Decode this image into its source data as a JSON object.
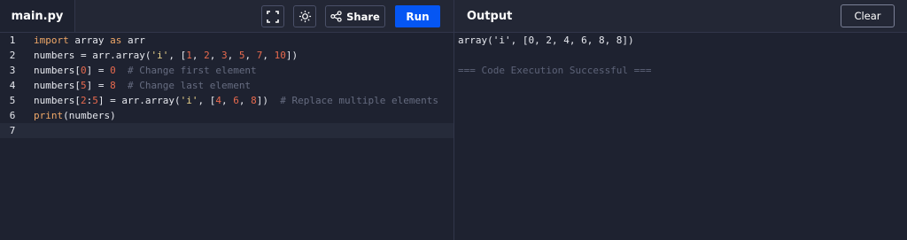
{
  "editor": {
    "filename": "main.py",
    "share_label": "Share",
    "run_label": "Run",
    "lines": [
      {
        "no": "1",
        "tokens": [
          [
            "kw",
            "import"
          ],
          [
            "txt",
            " array "
          ],
          [
            "kw",
            "as"
          ],
          [
            "txt",
            " arr"
          ]
        ]
      },
      {
        "no": "2",
        "tokens": [
          [
            "txt",
            "numbers = arr.array("
          ],
          [
            "str",
            "'i'"
          ],
          [
            "txt",
            ", ["
          ],
          [
            "num",
            "1"
          ],
          [
            "txt",
            ", "
          ],
          [
            "num",
            "2"
          ],
          [
            "txt",
            ", "
          ],
          [
            "num",
            "3"
          ],
          [
            "txt",
            ", "
          ],
          [
            "num",
            "5"
          ],
          [
            "txt",
            ", "
          ],
          [
            "num",
            "7"
          ],
          [
            "txt",
            ", "
          ],
          [
            "num",
            "10"
          ],
          [
            "txt",
            "])"
          ]
        ]
      },
      {
        "no": "3",
        "tokens": [
          [
            "txt",
            "numbers["
          ],
          [
            "num",
            "0"
          ],
          [
            "txt",
            "] = "
          ],
          [
            "num",
            "0"
          ],
          [
            "txt",
            "  "
          ],
          [
            "cmt",
            "# Change first element"
          ]
        ]
      },
      {
        "no": "4",
        "tokens": [
          [
            "txt",
            "numbers["
          ],
          [
            "num",
            "5"
          ],
          [
            "txt",
            "] = "
          ],
          [
            "num",
            "8"
          ],
          [
            "txt",
            "  "
          ],
          [
            "cmt",
            "# Change last element"
          ]
        ]
      },
      {
        "no": "5",
        "tokens": [
          [
            "txt",
            "numbers["
          ],
          [
            "num",
            "2"
          ],
          [
            "txt",
            ":"
          ],
          [
            "num",
            "5"
          ],
          [
            "txt",
            "] = arr.array("
          ],
          [
            "str",
            "'i'"
          ],
          [
            "txt",
            ", ["
          ],
          [
            "num",
            "4"
          ],
          [
            "txt",
            ", "
          ],
          [
            "num",
            "6"
          ],
          [
            "txt",
            ", "
          ],
          [
            "num",
            "8"
          ],
          [
            "txt",
            "])  "
          ],
          [
            "cmt",
            "# Replace multiple elements"
          ]
        ]
      },
      {
        "no": "6",
        "tokens": [
          [
            "kw",
            "print"
          ],
          [
            "txt",
            "(numbers)"
          ]
        ]
      },
      {
        "no": "7",
        "tokens": []
      }
    ]
  },
  "output": {
    "title": "Output",
    "clear_label": "Clear",
    "lines": [
      "array('i', [0, 2, 4, 6, 8, 8])",
      "",
      "=== Code Execution Successful ==="
    ]
  },
  "icons": {
    "fullscreen": "fullscreen-icon",
    "theme": "sun-icon",
    "share": "share-icon"
  }
}
